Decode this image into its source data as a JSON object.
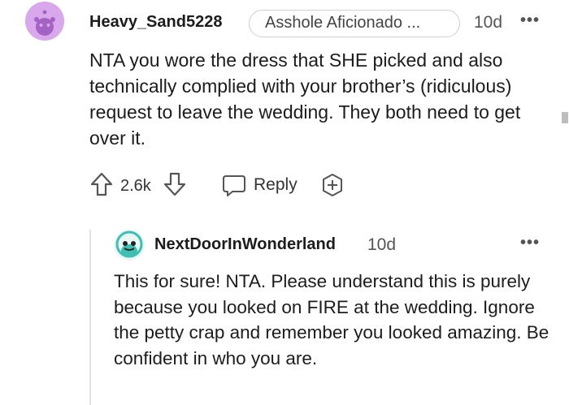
{
  "comment": {
    "username": "Heavy_Sand5228",
    "flair": "Asshole Aficionado ...",
    "time": "10d",
    "more": "•••",
    "body": "NTA you wore the dress that SHE picked and also technically complied with your brother’s (ridiculous) request to leave the wedding. They both need to get over it.",
    "vote_count": "2.6k",
    "reply_label": "Reply",
    "icons": [
      "snoo-avatar-icon",
      "upvote-icon",
      "downvote-icon",
      "reply-icon",
      "award-icon",
      "more-options-icon"
    ]
  },
  "reply": {
    "username": "NextDoorInWonderland",
    "time": "10d",
    "more": "•••",
    "body": "This for sure! NTA. Please understand this is purely because you looked on FIRE at the wedding. Ignore the petty crap and remember you looked amazing. Be confident in who you are.",
    "icons": [
      "snoo-avatar-icon",
      "more-options-icon"
    ]
  },
  "colors": {
    "avatar_purple": "#d9a8ec",
    "avatar_teal": "#3dbfb3",
    "text": "#1c1c1c",
    "muted": "#555555",
    "border": "#d0d0d0"
  }
}
